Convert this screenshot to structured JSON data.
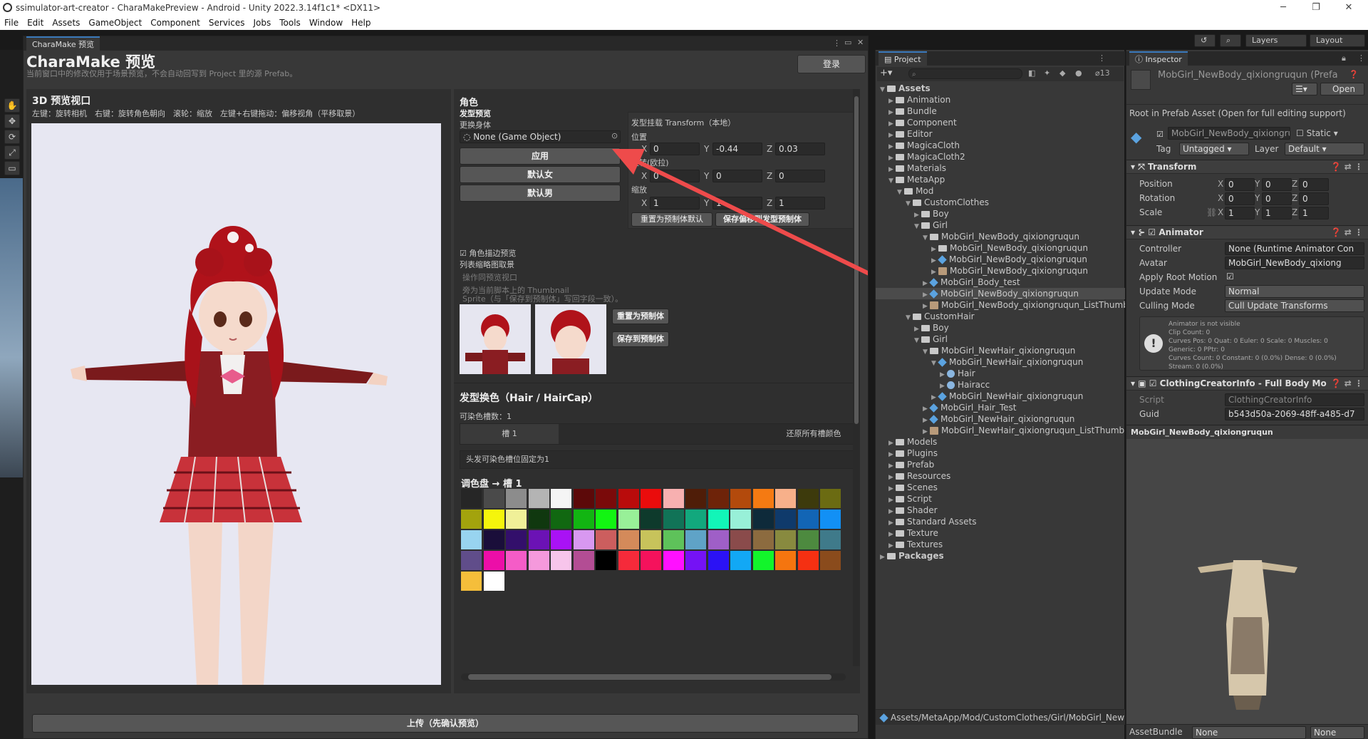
{
  "window": {
    "title": "ssimulator-art-creator - CharaMakePreview - Android - Unity 2022.3.14f1c1* <DX11>",
    "min": "─",
    "max": "❐",
    "close": "✕"
  },
  "menu": [
    "File",
    "Edit",
    "Assets",
    "GameObject",
    "Component",
    "Services",
    "Jobs",
    "Tools",
    "Window",
    "Help"
  ],
  "toolbar": {
    "layers": "Layers",
    "layout": "Layout"
  },
  "chara": {
    "tab": "CharaMake 预览",
    "title": "CharaMake 预览",
    "subtitle": "当前窗口中的修改仅用于场景预览，不会自动回写到 Project 里的源 Prefab。",
    "login": "登录",
    "viewport": {
      "title": "3D 预览视口",
      "hint": "左键：旋转相机　右键：旋转角色朝向　滚轮：缩放　左键+右键拖动：偏移视角（平移取景）"
    },
    "role": {
      "header": "角色",
      "hair_preview": "发型预览",
      "change_body": "更换身体",
      "object_field": "None (Game Object)",
      "apply": "应用",
      "default_female": "默认女",
      "default_male": "默认男"
    },
    "transform": {
      "header": "发型挂载 Transform（本地）",
      "position": "位置",
      "rotation": "旋转(欧拉)",
      "scale": "缩放",
      "pos": {
        "x": "0",
        "y": "-0.44",
        "z": "0.03"
      },
      "rot": {
        "x": "0",
        "y": "0",
        "z": "0"
      },
      "scl": {
        "x": "1",
        "y": "1",
        "z": "1"
      },
      "reset": "重置为预制体默认",
      "save": "保存偏移到发型预制体"
    },
    "outline_preview": "角色描边预览",
    "thumb": {
      "title": "列表缩略图取景",
      "line1": "操作同预览视口",
      "line2": "旁为当前脚本上的 Thumbnail",
      "line3": "Sprite（与「保存到预制体」写回字段一致）。",
      "reset": "重置为预制体",
      "save": "保存到预制体"
    },
    "hair_color": {
      "header": "发型换色（Hair / HairCap）",
      "slots_label": "可染色槽数：",
      "slots_count": "1",
      "slot_tab": "槽 1",
      "restore": "还原所有槽颜色",
      "note": "头发可染色槽位固定为1",
      "palette_title": "调色盘 → 槽 1"
    },
    "upload": "上传（先确认预览）"
  },
  "palette": [
    "#262626",
    "#4a4a4a",
    "#8c8c8c",
    "#b4b4b4",
    "#f5f5f5",
    "#5c0909",
    "#7a0a0a",
    "#b90b0b",
    "#ea0c0c",
    "#f7b0b0",
    "#4f1d08",
    "#6e2309",
    "#b34a0c",
    "#f57a12",
    "#f7b08a",
    "#3d3a0c",
    "#6b6b12",
    "#a3a30d",
    "#f5f50c",
    "#f0f098",
    "#10380f",
    "#116811",
    "#12b512",
    "#12f512",
    "#98f098",
    "#0e3a2c",
    "#117357",
    "#12a87d",
    "#12f5b8",
    "#98f0d8",
    "#0e2a3a",
    "#0f3a6b",
    "#1265b5",
    "#1290f5",
    "#98d4f0",
    "#1a0e3a",
    "#330f6b",
    "#6b12b5",
    "#a912f5",
    "#d898f0",
    "#cc5e5e",
    "#d48a5a",
    "#c7c35b",
    "#5ec25a",
    "#5fa3c7",
    "#9f5fc7",
    "#8a4b4b",
    "#8c6b3f",
    "#888a3f",
    "#4d8a3f",
    "#3f7a8a",
    "#604d8a",
    "#ec0ea8",
    "#f55cc7",
    "#f599dc",
    "#f7c5eb",
    "#b34d94",
    "#000000",
    "#f52a3a",
    "#f5125c",
    "#ff10ff",
    "#7512f5",
    "#2b12f5",
    "#12a8f5",
    "#12f52b",
    "#f5750f",
    "#f53012",
    "#8a4b1c",
    "#f5be3a",
    "#ffffff"
  ],
  "project": {
    "tab": "Project",
    "count": "13",
    "path": "Assets/MetaApp/Mod/CustomClothes/Girl/MobGirl_NewB",
    "tree": [
      {
        "t": "Assets",
        "d": 0,
        "k": "f",
        "o": 1,
        "b": 1
      },
      {
        "t": "Animation",
        "d": 1,
        "k": "f"
      },
      {
        "t": "Bundle",
        "d": 1,
        "k": "f"
      },
      {
        "t": "Component",
        "d": 1,
        "k": "f"
      },
      {
        "t": "Editor",
        "d": 1,
        "k": "f"
      },
      {
        "t": "MagicaCloth",
        "d": 1,
        "k": "f"
      },
      {
        "t": "MagicaCloth2",
        "d": 1,
        "k": "f"
      },
      {
        "t": "Materials",
        "d": 1,
        "k": "f"
      },
      {
        "t": "MetaApp",
        "d": 1,
        "k": "f",
        "o": 1
      },
      {
        "t": "Mod",
        "d": 2,
        "k": "f",
        "o": 1
      },
      {
        "t": "CustomClothes",
        "d": 3,
        "k": "f",
        "o": 1
      },
      {
        "t": "Boy",
        "d": 4,
        "k": "f"
      },
      {
        "t": "Girl",
        "d": 4,
        "k": "f",
        "o": 1
      },
      {
        "t": "MobGirl_NewBody_qixiongruqun",
        "d": 5,
        "k": "f",
        "o": 1
      },
      {
        "t": "MobGirl_NewBody_qixiongruqun",
        "d": 6,
        "k": "f"
      },
      {
        "t": "MobGirl_NewBody_qixiongruqun",
        "d": 6,
        "k": "p"
      },
      {
        "t": "MobGirl_NewBody_qixiongruqun",
        "d": 6,
        "k": "i"
      },
      {
        "t": "MobGirl_Body_test",
        "d": 5,
        "k": "p"
      },
      {
        "t": "MobGirl_NewBody_qixiongruqun",
        "d": 5,
        "k": "p",
        "s": 1
      },
      {
        "t": "MobGirl_NewBody_qixiongruqun_ListThumb",
        "d": 5,
        "k": "i"
      },
      {
        "t": "CustomHair",
        "d": 3,
        "k": "f",
        "o": 1
      },
      {
        "t": "Boy",
        "d": 4,
        "k": "f"
      },
      {
        "t": "Girl",
        "d": 4,
        "k": "f",
        "o": 1
      },
      {
        "t": "MobGirl_NewHair_qixiongruqun",
        "d": 5,
        "k": "f",
        "o": 1
      },
      {
        "t": "MobGirl_NewHair_qixiongruqun",
        "d": 6,
        "k": "p",
        "o": 1
      },
      {
        "t": "Hair",
        "d": 7,
        "k": "m"
      },
      {
        "t": "Hairacc",
        "d": 7,
        "k": "m"
      },
      {
        "t": "MobGirl_NewHair_qixiongruqun",
        "d": 6,
        "k": "p"
      },
      {
        "t": "MobGirl_Hair_Test",
        "d": 5,
        "k": "p"
      },
      {
        "t": "MobGirl_NewHair_qixiongruqun",
        "d": 5,
        "k": "p"
      },
      {
        "t": "MobGirl_NewHair_qixiongruqun_ListThumbr",
        "d": 5,
        "k": "i"
      },
      {
        "t": "Models",
        "d": 1,
        "k": "f"
      },
      {
        "t": "Plugins",
        "d": 1,
        "k": "f"
      },
      {
        "t": "Prefab",
        "d": 1,
        "k": "f"
      },
      {
        "t": "Resources",
        "d": 1,
        "k": "f"
      },
      {
        "t": "Scenes",
        "d": 1,
        "k": "f"
      },
      {
        "t": "Script",
        "d": 1,
        "k": "f"
      },
      {
        "t": "Shader",
        "d": 1,
        "k": "f"
      },
      {
        "t": "Standard Assets",
        "d": 1,
        "k": "f"
      },
      {
        "t": "Texture",
        "d": 1,
        "k": "f"
      },
      {
        "t": "Textures",
        "d": 1,
        "k": "f"
      },
      {
        "t": "Packages",
        "d": 0,
        "k": "f",
        "b": 1
      }
    ]
  },
  "inspector": {
    "tab": "Inspector",
    "asset_name": "MobGirl_NewBody_qixiongruqun (Prefa",
    "open": "Open",
    "root_note": "Root in Prefab Asset (Open for full editing support)",
    "go_name": "MobGirl_NewBody_qixiongruc",
    "static": "Static",
    "tag_label": "Tag",
    "tag": "Untagged",
    "layer_label": "Layer",
    "layer": "Default",
    "transform": {
      "header": "Transform",
      "position": "Position",
      "rotation": "Rotation",
      "scale": "Scale",
      "pos": [
        "0",
        "0",
        "0"
      ],
      "rot": [
        "0",
        "0",
        "0"
      ],
      "scl": [
        "1",
        "1",
        "1"
      ]
    },
    "animator": {
      "header": "Animator",
      "controller_label": "Controller",
      "controller": "None (Runtime Animator Con",
      "avatar_label": "Avatar",
      "avatar": "MobGirl_NewBody_qixiong",
      "root_motion": "Apply Root Motion",
      "update_label": "Update Mode",
      "update": "Normal",
      "culling_label": "Culling Mode",
      "culling": "Cull Update Transforms",
      "info": [
        "Animator is not visible",
        "Clip Count: 0",
        "Curves Pos: 0 Quat: 0 Euler: 0 Scale: 0 Muscles: 0",
        "Generic: 0 PPtr: 0",
        "Curves Count: 0 Constant: 0 (0.0%) Dense: 0 (0.0%)",
        "Stream: 0 (0.0%)"
      ]
    },
    "clothing": {
      "header": "ClothingCreatorInfo - Full Body Mo",
      "script_label": "Script",
      "script": "ClothingCreatorInfo",
      "guid_label": "Guid",
      "guid": "b543d50a-2069-48ff-a485-d7"
    },
    "preview_name": "MobGirl_NewBody_qixiongruqun",
    "assetbundle": "AssetBundle",
    "ab_value": "None",
    "ab_variant": "None"
  }
}
